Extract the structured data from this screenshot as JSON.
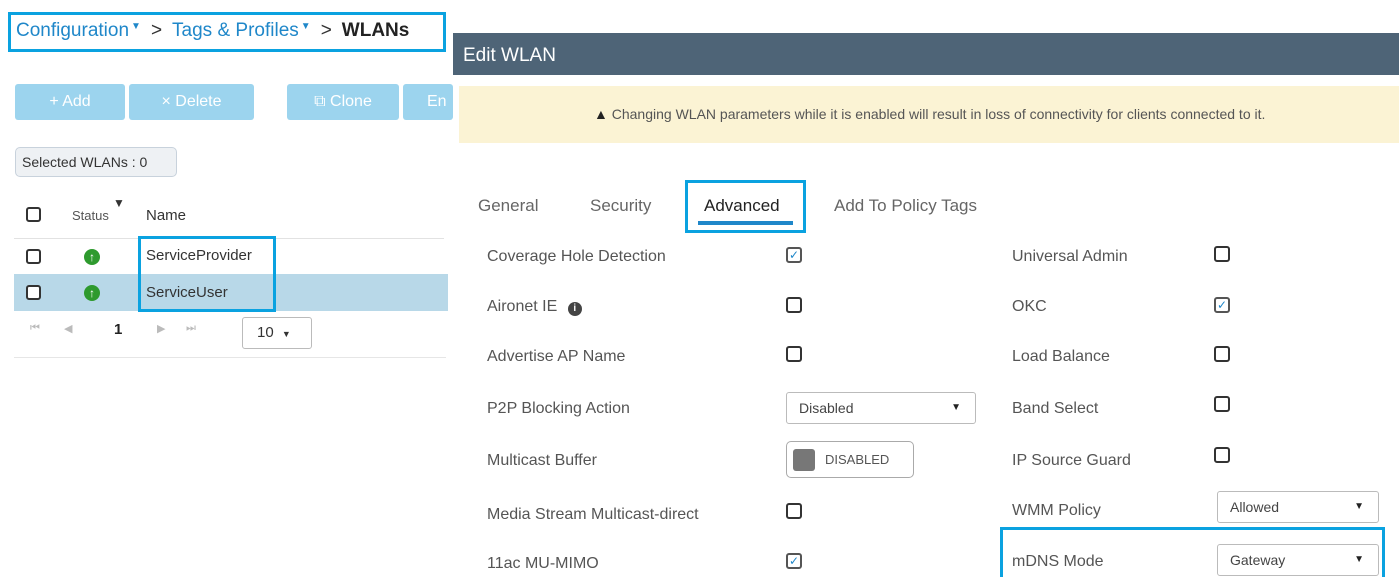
{
  "breadcrumb": {
    "configuration": "Configuration",
    "tags_profiles": "Tags & Profiles",
    "current": "WLANs",
    "separator": ">",
    "caret": "▼"
  },
  "toolbar": {
    "add_label": "+ Add",
    "delete_label": "× Delete",
    "clone_label": "Clone",
    "enable_label": "En"
  },
  "selected_wlans": "Selected WLANs : 0",
  "grid": {
    "columns": [
      "Status",
      "Name"
    ],
    "rows": [
      {
        "name": "ServiceProvider",
        "status": "up"
      },
      {
        "name": "ServiceUser",
        "status": "up"
      }
    ],
    "pager": {
      "page": "1",
      "page_size": "10"
    }
  },
  "edit": {
    "title": "Edit WLAN",
    "warning": "Changing WLAN parameters while it is enabled will result in loss of connectivity for clients connected to it.",
    "tabs": [
      "General",
      "Security",
      "Advanced",
      "Add To Policy Tags"
    ],
    "active_tab": "Advanced",
    "left_fields": [
      {
        "label": "Coverage Hole Detection",
        "type": "checkbox",
        "checked": true
      },
      {
        "label": "Aironet IE",
        "type": "checkbox",
        "checked": false
      },
      {
        "label": "Advertise AP Name",
        "type": "checkbox",
        "checked": false
      },
      {
        "label": "P2P Blocking Action",
        "type": "select",
        "value": "Disabled"
      },
      {
        "label": "Multicast Buffer",
        "type": "toggle",
        "value": "DISABLED"
      },
      {
        "label": "Media Stream Multicast-direct",
        "type": "checkbox",
        "checked": false
      },
      {
        "label": "11ac MU-MIMO",
        "type": "checkbox",
        "checked": true
      }
    ],
    "right_fields": [
      {
        "label": "Universal Admin",
        "type": "checkbox",
        "checked": false
      },
      {
        "label": "OKC",
        "type": "checkbox",
        "checked": true
      },
      {
        "label": "Load Balance",
        "type": "checkbox",
        "checked": false
      },
      {
        "label": "Band Select",
        "type": "checkbox",
        "checked": false
      },
      {
        "label": "IP Source Guard",
        "type": "checkbox",
        "checked": false
      },
      {
        "label": "WMM Policy",
        "type": "select",
        "value": "Allowed"
      },
      {
        "label": "mDNS Mode",
        "type": "select",
        "value": "Gateway"
      }
    ]
  },
  "colors": {
    "accent": "#1f87c9",
    "highlight": "#0aa2e0",
    "header": "#4e6477",
    "warning_bg": "#fbf3d4",
    "status_up": "#2e9a2e"
  }
}
